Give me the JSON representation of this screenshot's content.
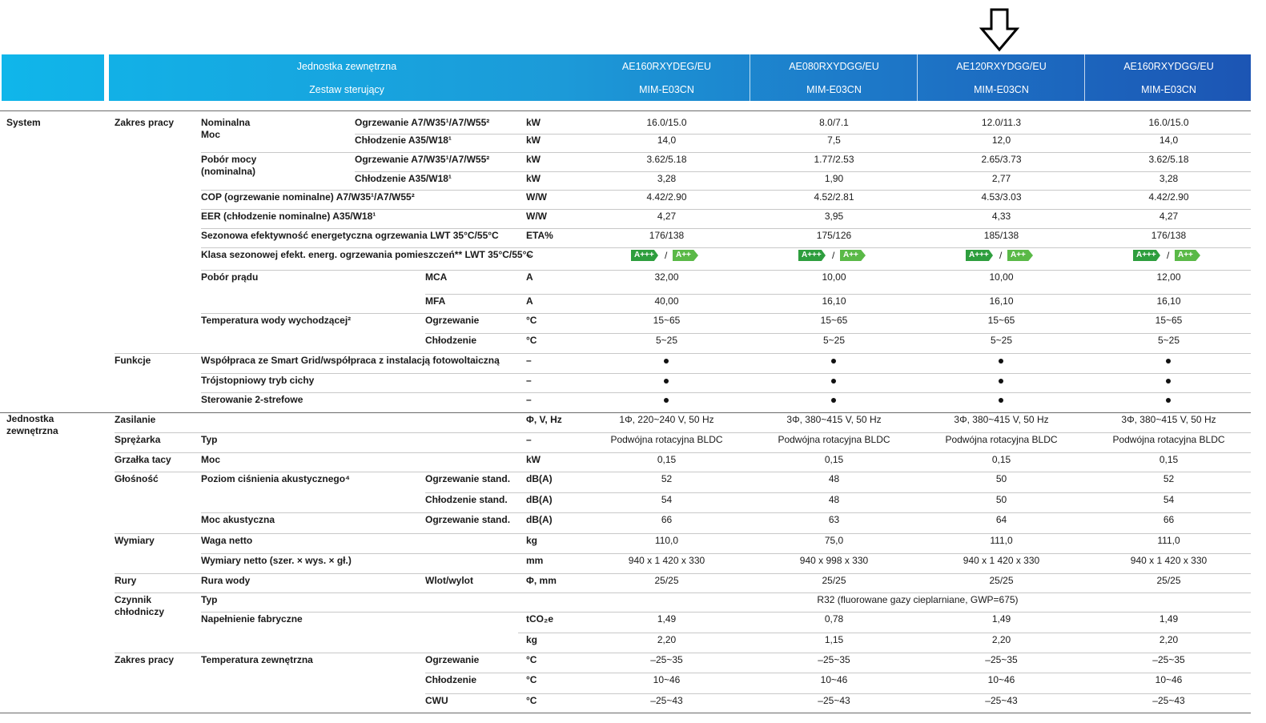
{
  "header": {
    "left_line1": "Jednostka zewnętrzna",
    "left_line2": "Zestaw sterujący",
    "models": [
      {
        "unit": "AE160RXYDEG/EU",
        "kit": "MIM-E03CN"
      },
      {
        "unit": "AE080RXYDGG/EU",
        "kit": "MIM-E03CN"
      },
      {
        "unit": "AE120RXYDGG/EU",
        "kit": "MIM-E03CN"
      },
      {
        "unit": "AE160RXYDGG/EU",
        "kit": "MIM-E03CN"
      }
    ]
  },
  "arrow_icon": "down-arrow-icon",
  "colors": {
    "band_start": "#10b6ea",
    "band_end": "#1c55b4",
    "class_a3": "#2e9e3e",
    "class_a2": "#5ab947"
  },
  "energy_class": {
    "a3": "A+++",
    "a2": "A++",
    "sep": "/"
  },
  "groups": {
    "system": "System",
    "outdoor_l1": "Jednostka",
    "outdoor_l2": "zewnętrzna"
  },
  "rows": [
    {
      "c2": "Zakres pracy",
      "c3": "Nominalna",
      "c3b": "Moc",
      "c4": "Ogrzewanie A7/W35¹/A7/W55²",
      "unit": "kW",
      "v": [
        "16.0/15.0",
        "8.0/7.1",
        "12.0/11.3",
        "16.0/15.0"
      ]
    },
    {
      "c4": "Chłodzenie A35/W18¹",
      "unit": "kW",
      "v": [
        "14,0",
        "7,5",
        "12,0",
        "14,0"
      ]
    },
    {
      "c3": "Pobór mocy",
      "c3b": "(nominalna)",
      "c4": "Ogrzewanie A7/W35¹/A7/W55²",
      "unit": "kW",
      "v": [
        "3.62/5.18",
        "1.77/2.53",
        "2.65/3.73",
        "3.62/5.18"
      ]
    },
    {
      "c4": "Chłodzenie A35/W18¹",
      "unit": "kW",
      "v": [
        "3,28",
        "1,90",
        "2,77",
        "3,28"
      ]
    },
    {
      "c3": "COP (ogrzewanie nominalne) A7/W35¹/A7/W55²",
      "unit": "W/W",
      "v": [
        "4.42/2.90",
        "4.52/2.81",
        "4.53/3.03",
        "4.42/2.90"
      ]
    },
    {
      "c3": "EER (chłodzenie nominalne) A35/W18¹",
      "unit": "W/W",
      "v": [
        "4,27",
        "3,95",
        "4,33",
        "4,27"
      ]
    },
    {
      "c3": "Sezonowa efektywność energetyczna ogrzewania LWT 35°C/55°C",
      "unit": "ETA%",
      "v": [
        "176/138",
        "175/126",
        "185/138",
        "176/138"
      ]
    },
    {
      "c3": "Klasa sezonowej efekt. energ. ogrzewania pomieszczeń** LWT 35°C/55°C",
      "unit": "–",
      "badges": true
    },
    {
      "c3": "Pobór prądu",
      "c5": "MCA",
      "unit": "A",
      "v": [
        "32,00",
        "10,00",
        "10,00",
        "12,00"
      ]
    },
    {
      "c5": "MFA",
      "unit": "A",
      "v": [
        "40,00",
        "16,10",
        "16,10",
        "16,10"
      ]
    },
    {
      "c3": "Temperatura wody wychodzącej²",
      "c5": "Ogrzewanie",
      "unit": "°C",
      "v": [
        "15~65",
        "15~65",
        "15~65",
        "15~65"
      ]
    },
    {
      "c5": "Chłodzenie",
      "unit": "°C",
      "v": [
        "5~25",
        "5~25",
        "5~25",
        "5~25"
      ]
    },
    {
      "c2": "Funkcje",
      "c3": "Współpraca ze Smart Grid/współpraca z instalacją fotowoltaiczną",
      "unit": "–",
      "dots": true
    },
    {
      "c3": "Trójstopniowy tryb cichy",
      "unit": "–",
      "dots": true
    },
    {
      "c3": "Sterowanie 2-strefowe",
      "unit": "–",
      "dots": true
    },
    {
      "c2": "Zasilanie",
      "unit": "Φ, V, Hz",
      "v": [
        "1Φ, 220~240 V, 50 Hz",
        "3Φ, 380~415 V, 50 Hz",
        "3Φ, 380~415 V, 50 Hz",
        "3Φ, 380~415 V, 50 Hz"
      ]
    },
    {
      "c2": "Sprężarka",
      "c3": "Typ",
      "unit": "–",
      "v": [
        "Podwójna rotacyjna BLDC",
        "Podwójna rotacyjna BLDC",
        "Podwójna rotacyjna BLDC",
        "Podwójna rotacyjna BLDC"
      ]
    },
    {
      "c2": "Grzałka tacy",
      "c3": "Moc",
      "unit": "kW",
      "v": [
        "0,15",
        "0,15",
        "0,15",
        "0,15"
      ]
    },
    {
      "c2": "Głośność",
      "c3": "Poziom ciśnienia akustycznego⁴",
      "c5": "Ogrzewanie stand.",
      "unit": "dB(A)",
      "v": [
        "52",
        "48",
        "50",
        "52"
      ]
    },
    {
      "c5": "Chłodzenie stand.",
      "unit": "dB(A)",
      "v": [
        "54",
        "48",
        "50",
        "54"
      ]
    },
    {
      "c3": "Moc akustyczna",
      "c5": "Ogrzewanie stand.",
      "unit": "dB(A)",
      "v": [
        "66",
        "63",
        "64",
        "66"
      ]
    },
    {
      "c2": "Wymiary",
      "c3": "Waga netto",
      "unit": "kg",
      "v": [
        "110,0",
        "75,0",
        "111,0",
        "111,0"
      ]
    },
    {
      "c3": "Wymiary netto (szer. × wys. × gł.)",
      "unit": "mm",
      "v": [
        "940 x 1 420 x 330",
        "940 x 998 x 330",
        "940 x 1 420 x 330",
        "940 x 1 420 x 330"
      ]
    },
    {
      "c2": "Rury",
      "c3": "Rura wody",
      "c5": "Wlot/wylot",
      "unit": "Φ, mm",
      "v": [
        "25/25",
        "25/25",
        "25/25",
        "25/25"
      ]
    },
    {
      "c2": "Czynnik",
      "c2b": "chłodniczy",
      "c3": "Typ",
      "span": "R32 (fluorowane gazy cieplarniane, GWP=675)"
    },
    {
      "c3": "Napełnienie fabryczne",
      "unit": "tCO₂e",
      "v": [
        "1,49",
        "0,78",
        "1,49",
        "1,49"
      ]
    },
    {
      "unit": "kg",
      "v": [
        "2,20",
        "1,15",
        "2,20",
        "2,20"
      ]
    },
    {
      "c2": "Zakres pracy",
      "c3": "Temperatura zewnętrzna",
      "c5": "Ogrzewanie",
      "unit": "°C",
      "v": [
        "–25~35",
        "–25~35",
        "–25~35",
        "–25~35"
      ]
    },
    {
      "c5": "Chłodzenie",
      "unit": "°C",
      "v": [
        "10~46",
        "10~46",
        "10~46",
        "10~46"
      ]
    },
    {
      "c5": "CWU",
      "unit": "°C",
      "v": [
        "–25~43",
        "–25~43",
        "–25~43",
        "–25~43"
      ]
    }
  ]
}
